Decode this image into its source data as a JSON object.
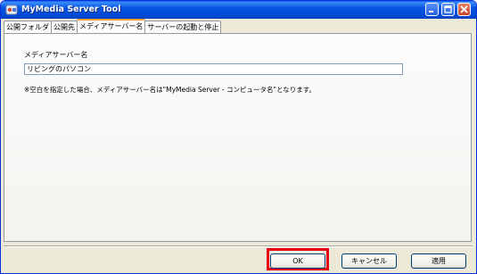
{
  "window": {
    "title": "MyMedia Server Tool"
  },
  "tabs": [
    {
      "label": "公開フォルダ"
    },
    {
      "label": "公開先"
    },
    {
      "label": "メディアサーバー名",
      "active": true
    },
    {
      "label": "サーバーの起動と停止"
    }
  ],
  "main": {
    "field_label": "メディアサーバー名",
    "field_value": "リビングのパソコン",
    "note": "※空白を指定した場合、メディアサーバー名は\"MyMedia Server - コンピュータ名\"となります。"
  },
  "buttons": {
    "ok": "OK",
    "cancel": "キャンセル",
    "apply": "適用"
  },
  "colors": {
    "highlight": "#e60012",
    "titlebar": "#0148d1",
    "active_tab_accent": "#e7a23b"
  }
}
